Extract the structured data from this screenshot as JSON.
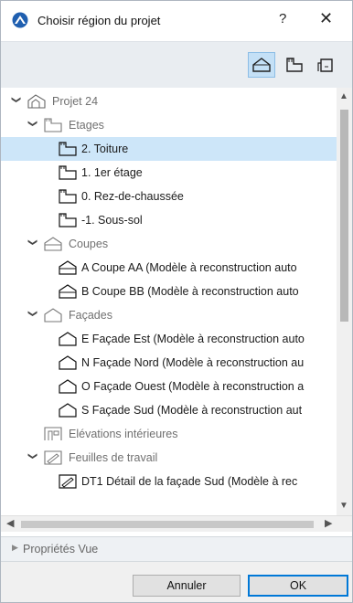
{
  "window": {
    "title": "Choisir région du projet",
    "help_label": "?",
    "close_label": "✕"
  },
  "toolbar": {
    "buttons": [
      {
        "name": "model-view-button",
        "icon": "house-icon",
        "active": true
      },
      {
        "name": "layouts-button",
        "icon": "layout-sheet-icon",
        "active": false
      },
      {
        "name": "publisher-button",
        "icon": "publisher-icon",
        "active": false
      }
    ]
  },
  "tree": {
    "items": [
      {
        "label": "Projet 24",
        "icon": "project-icon",
        "level": 0,
        "expanded": true,
        "dim": true
      },
      {
        "label": "Etages",
        "icon": "story-icon",
        "level": 1,
        "expanded": true,
        "dim": true
      },
      {
        "label": "2. Toiture",
        "icon": "story-icon",
        "level": 2,
        "selected": true
      },
      {
        "label": "1. 1er étage",
        "icon": "story-icon",
        "level": 2
      },
      {
        "label": "0. Rez-de-chaussée",
        "icon": "story-icon",
        "level": 2
      },
      {
        "label": "-1. Sous-sol",
        "icon": "story-icon",
        "level": 2
      },
      {
        "label": "Coupes",
        "icon": "section-icon",
        "level": 1,
        "expanded": true,
        "dim": true
      },
      {
        "label": "A Coupe AA (Modèle à reconstruction auto",
        "icon": "section-icon",
        "level": 2
      },
      {
        "label": "B Coupe BB (Modèle à reconstruction auto",
        "icon": "section-icon",
        "level": 2
      },
      {
        "label": "Façades",
        "icon": "elevation-icon",
        "level": 1,
        "expanded": true,
        "dim": true
      },
      {
        "label": "E Façade Est (Modèle à reconstruction auto",
        "icon": "elevation-icon",
        "level": 2
      },
      {
        "label": "N Façade Nord (Modèle à reconstruction au",
        "icon": "elevation-icon",
        "level": 2
      },
      {
        "label": "O Façade Ouest (Modèle à reconstruction a",
        "icon": "elevation-icon",
        "level": 2
      },
      {
        "label": "S Façade Sud (Modèle à reconstruction aut",
        "icon": "elevation-icon",
        "level": 2
      },
      {
        "label": "Elévations intérieures",
        "icon": "interior-elevation-icon",
        "level": 1,
        "dim": true
      },
      {
        "label": "Feuilles de travail",
        "icon": "worksheet-icon",
        "level": 1,
        "expanded": true,
        "dim": true
      },
      {
        "label": "DT1 Détail de la façade Sud (Modèle à rec",
        "icon": "worksheet-icon",
        "level": 2,
        "partial": true
      }
    ]
  },
  "properties_panel": {
    "label": "Propriétés Vue"
  },
  "buttons": {
    "cancel": "Annuler",
    "ok": "OK"
  },
  "colors": {
    "selection": "#cde6f9",
    "accent": "#0078d7",
    "toolbar_active": "#c4e0f6"
  }
}
